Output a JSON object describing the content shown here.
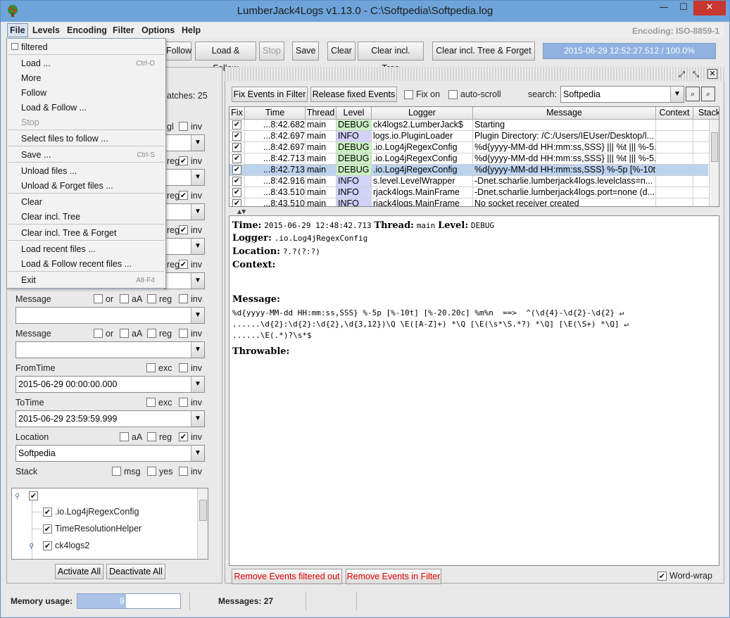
{
  "window": {
    "title": "LumberJack4Logs v1.13.0 - C:\\Softpedia\\Softpedia.log",
    "minimize": "—",
    "maximize": "☐",
    "close": "✕"
  },
  "menubar": [
    "File",
    "Levels",
    "Encoding",
    "Filter",
    "Options",
    "Help"
  ],
  "encoding_label": "Encoding: ISO-8859-1",
  "toolbar": {
    "follow": "Follow",
    "load_follow": "Load & Follow",
    "stop": "Stop",
    "save": "Save",
    "clear": "Clear",
    "clear_tree": "Clear incl. Tree",
    "clear_tree_forget": "Clear incl. Tree & Forget",
    "progress": "2015-06-29 12:52:27.512 / 100.0%"
  },
  "file_menu": {
    "filtered": "filtered",
    "items": [
      {
        "label": "Load ...",
        "shortcut": "Ctrl-O"
      },
      {
        "label": "More",
        "shortcut": ""
      },
      {
        "label": "Follow",
        "shortcut": ""
      },
      {
        "label": "Load & Follow ...",
        "shortcut": ""
      },
      {
        "label": "Stop",
        "shortcut": ""
      },
      {
        "label": "Select files to follow ...",
        "shortcut": ""
      },
      {
        "label": "Save ...",
        "shortcut": "Ctrl-S"
      },
      {
        "label": "Unload files ...",
        "shortcut": ""
      },
      {
        "label": "Unload & Forget files ...",
        "shortcut": ""
      },
      {
        "label": "Clear",
        "shortcut": ""
      },
      {
        "label": "Clear incl. Tree",
        "shortcut": ""
      },
      {
        "label": "Clear incl. Tree & Forget",
        "shortcut": ""
      },
      {
        "label": "Load recent files ...",
        "shortcut": ""
      },
      {
        "label": "Load & Follow recent files ...",
        "shortcut": ""
      },
      {
        "label": "Exit",
        "shortcut": "Alt-F4"
      }
    ]
  },
  "filter_panel": {
    "matches_label": "atches: 25",
    "row_suffix_gl": "gl",
    "reg": "reg",
    "inv": "inv",
    "or": "or",
    "aA": "aA",
    "exc": "exc",
    "msg": "msg",
    "yes": "yes",
    "message1": "Message",
    "message2": "Message",
    "from_time": "FromTime",
    "from_time_value": "2015-06-29 00:00:00.000",
    "to_time": "ToTime",
    "to_time_value": "2015-06-29 23:59:59.999",
    "location": "Location",
    "location_value": "Softpedia",
    "stack": "Stack",
    "tree": [
      "",
      ".io.Log4jRegexConfig",
      "TimeResolutionHelper",
      "ck4logs2"
    ],
    "activate_all": "Activate All",
    "deactivate_all": "Deactivate All"
  },
  "right_panel": {
    "fix_events": "Fix Events in Filter",
    "release_fixed": "Release fixed Events",
    "fix_on": "Fix on",
    "auto_scroll": "auto-scroll",
    "search_label": "search:",
    "search_value": "Softpedia",
    "columns": [
      "Fix",
      "Time",
      "Thread",
      "Level",
      "Logger",
      "Message",
      "Context",
      "Stack"
    ],
    "rows": [
      {
        "time": "...8:42.682",
        "thread": "main",
        "level": "DEBUG",
        "logger": "ck4logs2.LumberJack$",
        "message": "Starting"
      },
      {
        "time": "...8:42.697",
        "thread": "main",
        "level": "INFO",
        "logger": "logs.io.PluginLoader",
        "message": "Plugin Directory: /C:/Users/IEUser/Desktop/l..."
      },
      {
        "time": "...8:42.697",
        "thread": "main",
        "level": "DEBUG",
        "logger": ".io.Log4jRegexConfig",
        "message": "%d{yyyy-MM-dd HH:mm:ss,SSS} ||| %t ||| %-5..."
      },
      {
        "time": "...8:42.713",
        "thread": "main",
        "level": "DEBUG",
        "logger": ".io.Log4jRegexConfig",
        "message": "%d{yyyy-MM-dd HH:mm:ss,SSS} ||| %t ||| %-5..."
      },
      {
        "time": "...8:42.713",
        "thread": "main",
        "level": "DEBUG",
        "logger": ".io.Log4jRegexConfig",
        "message": "%d{yyyy-MM-dd HH:mm:ss,SSS} %-5p [%-10t..."
      },
      {
        "time": "...8:42.916",
        "thread": "main",
        "level": "INFO",
        "logger": "s.level.LevelWrapper",
        "message": "-Dnet.scharlie.lumberjack4logs.levelclass=n..."
      },
      {
        "time": "...8:43.510",
        "thread": "main",
        "level": "INFO",
        "logger": "rjack4logs.MainFrame",
        "message": "-Dnet.scharlie.lumberjack4logs.port=none (d..."
      },
      {
        "time": "...8:43.510",
        "thread": "main",
        "level": "INFO",
        "logger": "rjack4logs.MainFrame",
        "message": "No socket receiver created"
      }
    ],
    "detail": {
      "time_label": "Time:",
      "time_value": "2015-06-29 12:48:42.713",
      "thread_label": "Thread:",
      "thread_value": "main",
      "level_label": "Level:",
      "level_value": "DEBUG",
      "logger_label": "Logger:",
      "logger_value": ".io.Log4jRegexConfig",
      "location_label": "Location:",
      "location_value": "?.?(?:?)",
      "context_label": "Context:",
      "message_label": "Message:",
      "message_lines": [
        "%d{yyyy-MM-dd HH:mm:ss,SSS} %-5p [%-10t] [%-20.20c] %m%n  ==>  ^(\\d{4}-\\d{2}-\\d{2} ↵",
        "......\\d{2}:\\d{2}:\\d{2},\\d{3,12})\\Q \\E([A-Z]+) *\\Q [\\E(\\s*\\S.*?) *\\Q] [\\E(\\S+) *\\Q] ↵",
        "......\\E(.*)?\\s*$"
      ],
      "throwable_label": "Throwable:"
    },
    "remove_filtered_out": "Remove Events filtered out",
    "remove_in_filter": "Remove Events in Filter",
    "word_wrap": "Word-wrap"
  },
  "status": {
    "memory_label": "Memory usage:",
    "memory_value": "9 Mb",
    "messages": "Messages: 27"
  },
  "colors": {
    "debug": "#c9f1c2",
    "info": "#d2d2fb",
    "selected": "#bcd3ee",
    "title_bar": "#6ea4da"
  }
}
